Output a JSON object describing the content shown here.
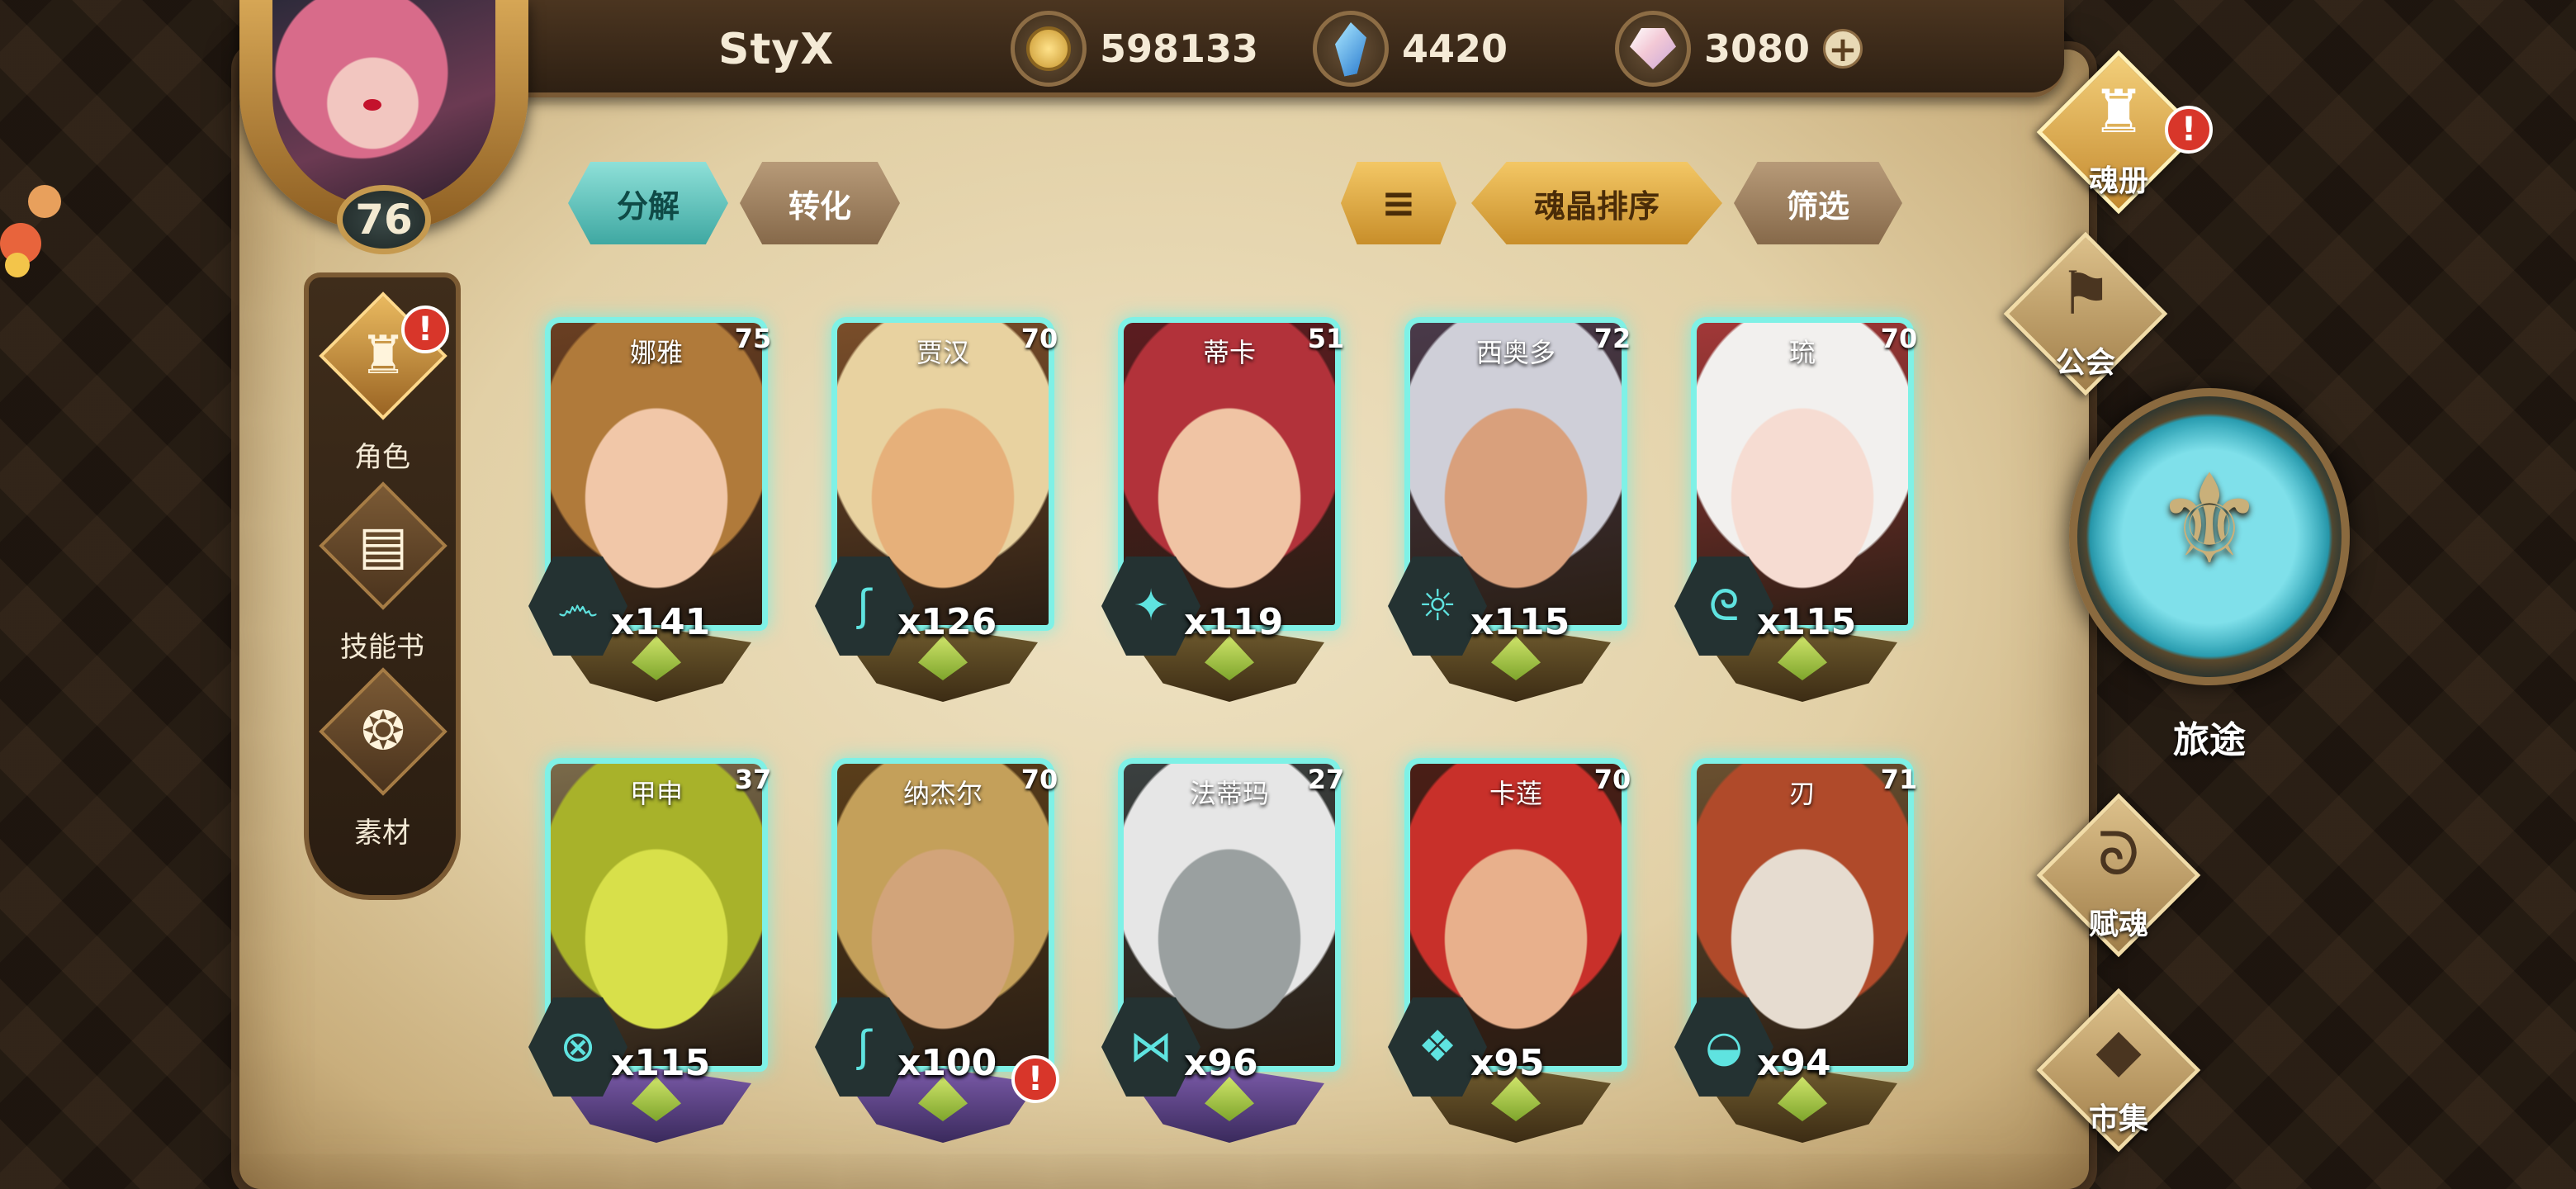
{
  "player": {
    "name": "StyX",
    "level": "76"
  },
  "currencies": [
    {
      "icon": "gold-coin-icon",
      "value": "598133"
    },
    {
      "icon": "blue-crystal-icon",
      "value": "4420"
    },
    {
      "icon": "pink-gem-icon",
      "value": "3080"
    }
  ],
  "left_menu": [
    {
      "icon": "character-crest-icon",
      "label": "角色",
      "active": true,
      "alert": "!"
    },
    {
      "icon": "skill-book-icon",
      "label": "技能书",
      "active": false
    },
    {
      "icon": "material-icon",
      "label": "素材",
      "active": false
    }
  ],
  "tabs": {
    "decompose": "分解",
    "transform": "转化",
    "sort_dir": "≡",
    "sort": "魂晶排序",
    "filter": "筛选"
  },
  "heroes": [
    {
      "name": "娜雅",
      "level": "75",
      "count": "x141",
      "glyph": "෴",
      "level_style": "dark",
      "crest": "gold",
      "art": [
        "#f1c7a8",
        "#b07a3a",
        "#6a3f22"
      ]
    },
    {
      "name": "贾汉",
      "level": "70",
      "count": "x126",
      "glyph": "ʃ",
      "level_style": "gold",
      "crest": "gold",
      "art": [
        "#e6b07a",
        "#e8d2a0",
        "#7a4e2a"
      ]
    },
    {
      "name": "蒂卡",
      "level": "51",
      "count": "x119",
      "glyph": "✦",
      "level_style": "dark",
      "crest": "gold",
      "art": [
        "#f0c4a4",
        "#b2323a",
        "#5c1c20"
      ]
    },
    {
      "name": "西奥多",
      "level": "72",
      "count": "x115",
      "glyph": "☼",
      "level_style": "dark",
      "crest": "gold",
      "art": [
        "#d9a07c",
        "#cfcfd8",
        "#4a3a4a"
      ]
    },
    {
      "name": "琉",
      "level": "70",
      "count": "x115",
      "glyph": "ᘓ",
      "level_style": "dark",
      "crest": "gold",
      "art": [
        "#f6dcd2",
        "#f2f0ee",
        "#a23838"
      ]
    },
    {
      "name": "甲申",
      "level": "37",
      "count": "x115",
      "glyph": "⊗",
      "level_style": "dark",
      "crest": "purple",
      "art": [
        "#d8e04a",
        "#a8b22a",
        "#7a6a4a"
      ]
    },
    {
      "name": "纳杰尔",
      "level": "70",
      "count": "x100",
      "glyph": "ʃ",
      "level_style": "gold",
      "crest": "purple",
      "art": [
        "#d2a47a",
        "#c4a05a",
        "#5a3e1a"
      ],
      "alert": "!"
    },
    {
      "name": "法蒂玛",
      "level": "27",
      "count": "x96",
      "glyph": "⋈",
      "level_style": "dark",
      "crest": "purple",
      "art": [
        "#9aa0a0",
        "#e6e6e6",
        "#3a4040"
      ]
    },
    {
      "name": "卡莲",
      "level": "70",
      "count": "x95",
      "glyph": "❖",
      "level_style": "dark",
      "crest": "gold",
      "art": [
        "#e8b08c",
        "#c8302a",
        "#4a1e16"
      ]
    },
    {
      "name": "刃",
      "level": "71",
      "count": "x94",
      "glyph": "◒",
      "level_style": "dark",
      "crest": "gold",
      "art": [
        "#e6dcd0",
        "#b04a2a",
        "#6a5030"
      ]
    }
  ],
  "right_menu": {
    "soul_book": {
      "icon": "soul-book-icon",
      "label": "魂册",
      "alert": "!"
    },
    "guild": {
      "icon": "guild-flag-icon",
      "label": "公会"
    },
    "journey": {
      "icon": "journey-emblem-icon",
      "label": "旅途"
    },
    "soul_gift": {
      "icon": "soul-swirl-icon",
      "label": "赋魂"
    },
    "market": {
      "icon": "market-gem-icon",
      "label": "市集"
    }
  },
  "colors": {
    "accent_teal": "#7ff1e6",
    "gold": "#f3c765",
    "alert_red": "#d8362a",
    "parchment": "#e2d0a6"
  }
}
